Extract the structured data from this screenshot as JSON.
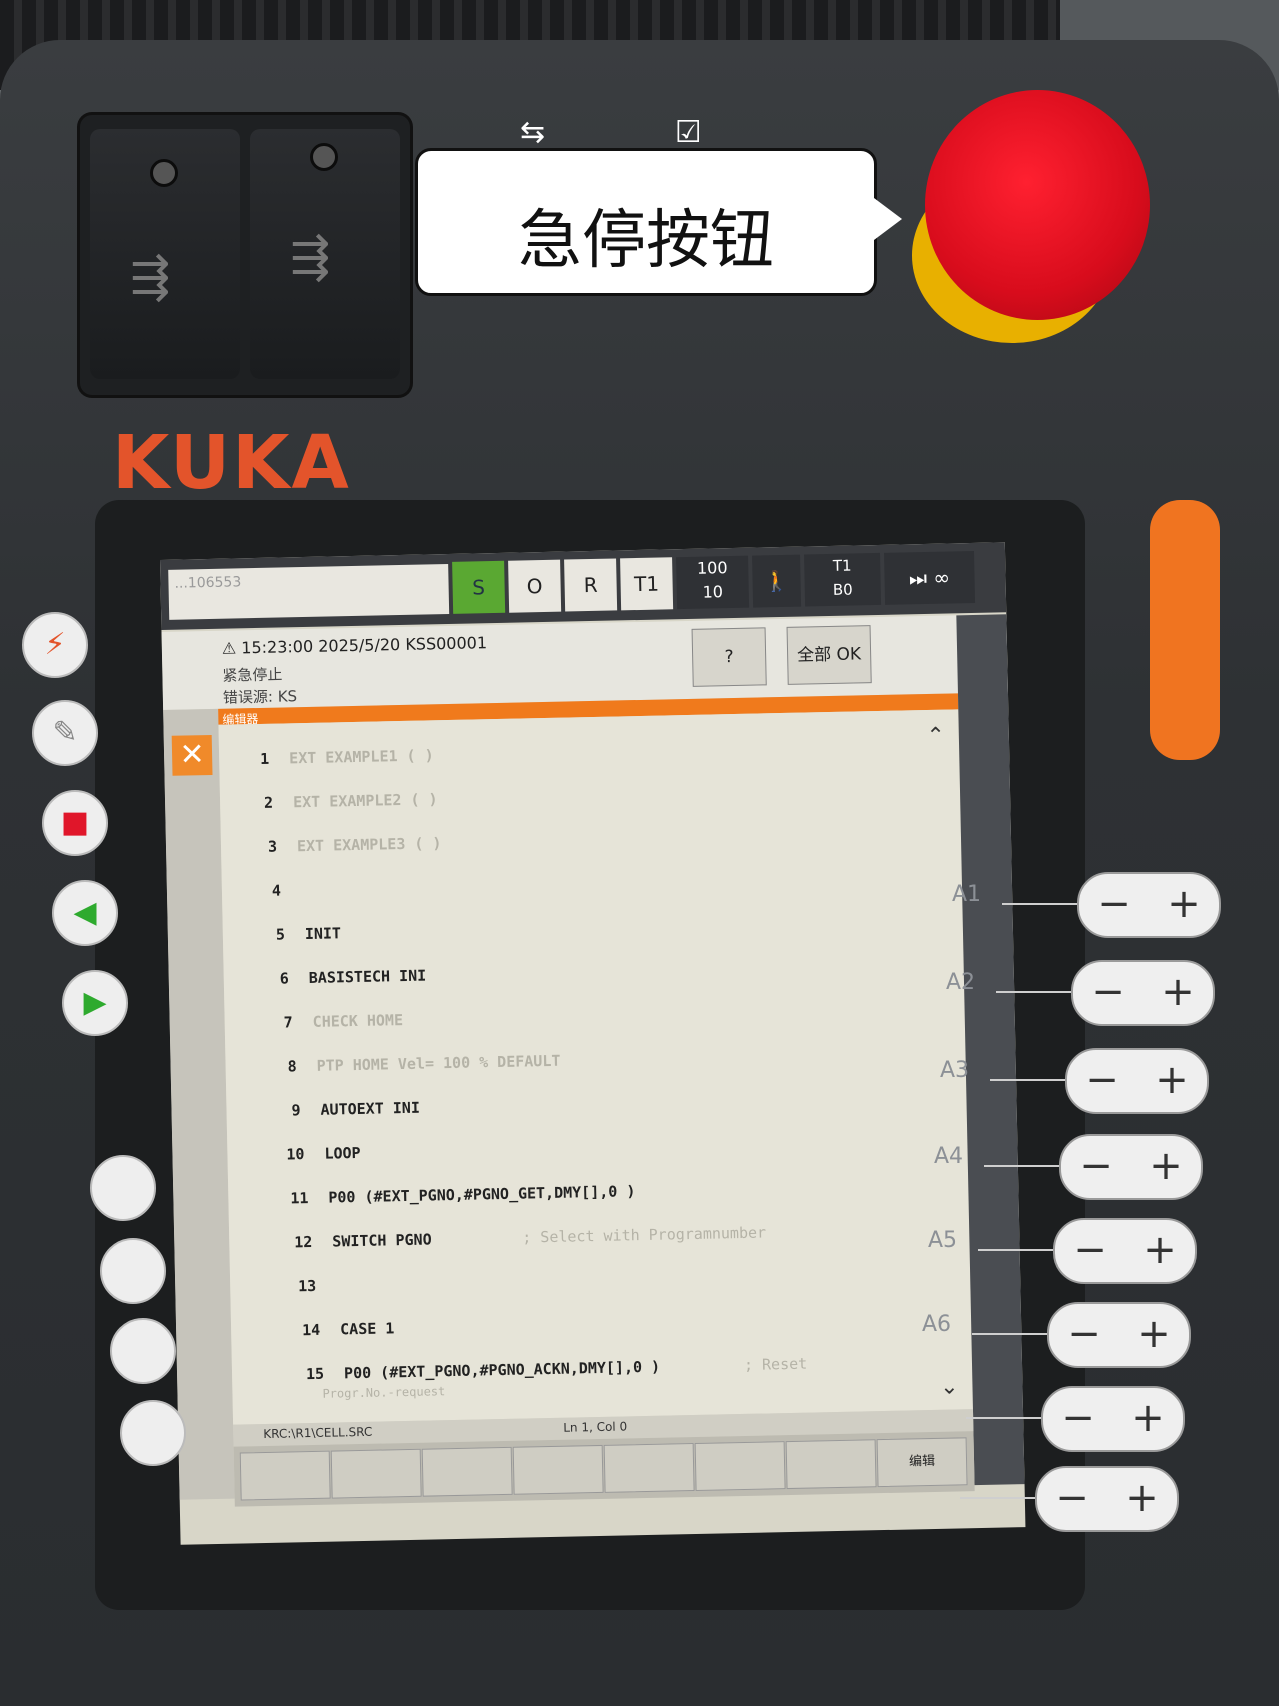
{
  "callout": {
    "text": "急停按钮"
  },
  "brand": {
    "logo": "KUKA"
  },
  "colors": {
    "brand_orange": "#e3542b",
    "estop_red": "#d80c1c",
    "estop_ring": "#e8b000"
  },
  "status_bar": {
    "robot_name": "...106553",
    "submit_label": "S",
    "run_label": "O",
    "robot_label": "R",
    "mode_label": "T1",
    "override_top": "100",
    "override_bottom": "10",
    "tool_top": "T1",
    "tool_bottom": "B0",
    "incremental": "∞"
  },
  "message": {
    "header": "15:23:00 2025/5/20 KSS00001",
    "line2": "紧急停止",
    "line3": "错误源: KS",
    "help_button": "?",
    "ack_all_button": "全部 OK",
    "editor_tab": "编辑器"
  },
  "editor": {
    "lines": [
      {
        "num": "1",
        "code": "EXT EXAMPLE1 ( )",
        "faded": true
      },
      {
        "num": "2",
        "code": "EXT EXAMPLE2 ( )",
        "faded": true
      },
      {
        "num": "3",
        "code": "EXT EXAMPLE3 ( )",
        "faded": true
      },
      {
        "num": "4",
        "code": "",
        "faded": false
      },
      {
        "num": "5",
        "code": "INIT",
        "faded": false
      },
      {
        "num": "6",
        "code": "BASISTECH INI",
        "faded": false
      },
      {
        "num": "7",
        "code": "CHECK HOME",
        "faded": true
      },
      {
        "num": "8",
        "code": "PTP HOME  Vel= 100 % DEFAULT",
        "faded": true
      },
      {
        "num": "9",
        "code": "AUTOEXT INI",
        "faded": false
      },
      {
        "num": "10",
        "code": "  LOOP",
        "faded": false
      },
      {
        "num": "11",
        "code": "    P00 (#EXT_PGNO,#PGNO_GET,DMY[],0 )",
        "faded": false
      },
      {
        "num": "12",
        "code": "    SWITCH  PGNO",
        "faded": false
      },
      {
        "num": "13",
        "code": "",
        "faded": false
      },
      {
        "num": "14",
        "code": "     CASE 1",
        "faded": false
      },
      {
        "num": "15",
        "code": "       P00 (#EXT_PGNO,#PGNO_ACKN,DMY[],0 )",
        "faded": false
      }
    ],
    "line12_comment": "; Select with Programnumber",
    "line15_comment": "; Reset",
    "overflow_comment": "Progr.No.-request",
    "path": "KRC:\\R1\\CELL.SRC",
    "cursor_pos": "Ln 1, Col 0"
  },
  "softkeys": [
    "",
    "",
    "",
    "",
    "",
    "",
    "",
    "编辑"
  ],
  "axes": [
    "A1",
    "A2",
    "A3",
    "A4",
    "A5",
    "A6"
  ]
}
